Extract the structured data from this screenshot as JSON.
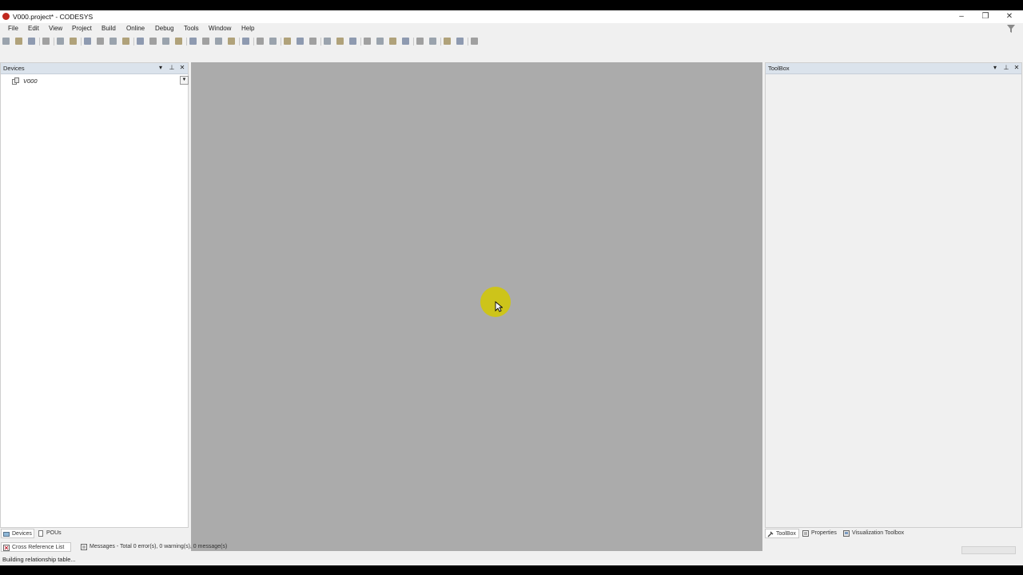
{
  "window": {
    "title": "V000.project* - CODESYS",
    "controls": {
      "minimize": "–",
      "restore": "❐",
      "close": "✕"
    }
  },
  "menu": [
    "File",
    "Edit",
    "View",
    "Project",
    "Build",
    "Online",
    "Debug",
    "Tools",
    "Window",
    "Help"
  ],
  "toolbar": {
    "icons": [
      "new-file-icon",
      "open-file-icon",
      "save-icon",
      "print-icon",
      "undo-icon",
      "redo-icon",
      "cut-icon",
      "copy-icon",
      "paste-icon",
      "delete-icon",
      "find-icon",
      "find-next-icon",
      "find-in-project-icon",
      "replace-icon",
      "bookmark-toggle-icon",
      "bookmark-next-icon",
      "bookmark-prev-icon",
      "bookmark-clear-icon",
      "open-window-icon",
      "generate-code-icon",
      "clean-icon",
      "build-icon",
      "login-icon",
      "logout-icon",
      "start-icon",
      "stop-icon",
      "reset-icon",
      "breakpoint-icon",
      "step-over-icon",
      "step-into-icon",
      "step-out-icon",
      "run-to-cursor-icon",
      "write-values-icon",
      "force-values-icon",
      "release-force-icon",
      "grid-icon"
    ]
  },
  "devices_panel": {
    "title": "Devices",
    "tree": [
      {
        "label": "V000"
      }
    ],
    "tabs": [
      {
        "label": "Devices",
        "active": true
      },
      {
        "label": "POUs",
        "active": false
      }
    ]
  },
  "toolbox_panel": {
    "title": "ToolBox",
    "tabs": [
      {
        "label": "ToolBox",
        "active": true
      },
      {
        "label": "Properties",
        "active": false
      },
      {
        "label": "Visualization Toolbox",
        "active": false
      }
    ]
  },
  "bottom_tabs": [
    {
      "label": "Cross Reference List"
    },
    {
      "label": "Messages - Total 0 error(s), 0 warning(s), 0 message(s)"
    }
  ],
  "status": {
    "text": "Building relationship table..."
  },
  "colors": {
    "accent_icon": "#c0281e",
    "editor_bg": "#ababab",
    "cursor_highlight": "#d2c800"
  }
}
